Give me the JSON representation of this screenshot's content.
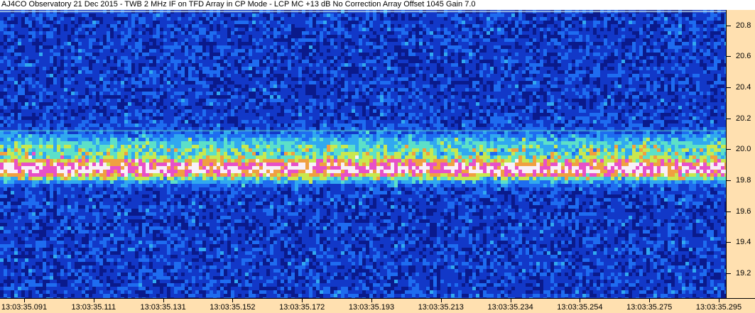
{
  "window": {
    "title": "AJ4CO Observatory 21 Dec 2015 - TWB 2 MHz IF on TFD Array in CP Mode - LCP  MC +13 dB  No Correction Array  Offset 1045  Gain 7.0"
  },
  "chart_data": {
    "type": "heatmap",
    "title": "AJ4CO Observatory 21 Dec 2015 - TWB 2 MHz IF on TFD Array in CP Mode - LCP  MC +13 dB  No Correction Array  Offset 1045  Gain 7.0",
    "xlabel": "",
    "ylabel": "",
    "x_ticks": [
      "13:03:35.091",
      "13:03:35.111",
      "13:03:35.131",
      "13:03:35.152",
      "13:03:35.172",
      "13:03:35.193",
      "13:03:35.213",
      "13:03:35.234",
      "13:03:35.254",
      "13:03:35.275",
      "13:03:35.295"
    ],
    "y_ticks": [
      "20.8",
      "20.6",
      "20.4",
      "20.2",
      "20.0",
      "19.8",
      "19.6",
      "19.4",
      "19.2"
    ],
    "y_tick_values": [
      20.8,
      20.6,
      20.4,
      20.2,
      20.0,
      19.8,
      19.6,
      19.4,
      19.2
    ],
    "ylim": [
      19.04,
      20.9
    ],
    "colormap": [
      "#0a1a8c",
      "#1238c8",
      "#1e6cf0",
      "#30a8f0",
      "#5ce0c8",
      "#c8e850",
      "#f0a040",
      "#e850c8",
      "#f8f0f8"
    ],
    "features": [
      {
        "kind": "emission-band",
        "center": 19.87,
        "half_width": 0.07,
        "intensity": 1.0
      },
      {
        "kind": "emission-band",
        "center": 20.01,
        "half_width": 0.09,
        "intensity": 0.45
      },
      {
        "kind": "narrow-line",
        "center": 20.89,
        "intensity": 0.75
      },
      {
        "kind": "narrow-line",
        "center": 20.12,
        "intensity": 0.5
      }
    ]
  }
}
